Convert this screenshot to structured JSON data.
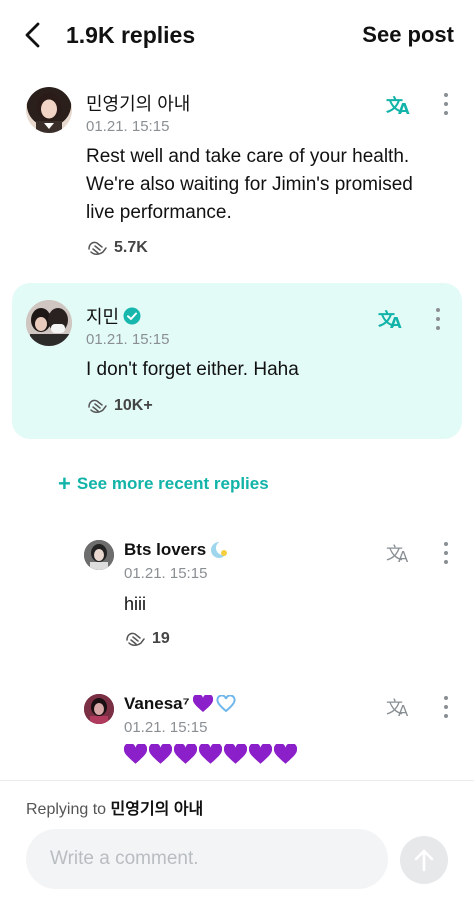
{
  "header": {
    "title": "1.9K replies",
    "see_post": "See post"
  },
  "comment1": {
    "name": "민영기의 아내",
    "time": "01.21. 15:15",
    "lines": [
      "Rest well and take care of your health.",
      "We're also waiting for Jimin's promised",
      "live performance."
    ],
    "likes": "5.7K"
  },
  "comment2": {
    "name": "지민",
    "time": "01.21. 15:15",
    "text": "I don't forget either. Haha",
    "likes": "10K+"
  },
  "see_more": "See more recent replies",
  "reply1": {
    "name": "Bts lovers",
    "time": "01.21. 15:15",
    "text": "hiii",
    "likes": "19"
  },
  "reply2": {
    "name": "Vanesa⁷",
    "time": "01.21. 15:15"
  },
  "footer": {
    "replying_prefix": "Replying to",
    "replying_to": "민영기의 아내",
    "placeholder": "Write a comment."
  },
  "colors": {
    "accent": "#12b3a8",
    "highlight_bg": "#e3fbf7",
    "heart": "#8b1fc9"
  }
}
